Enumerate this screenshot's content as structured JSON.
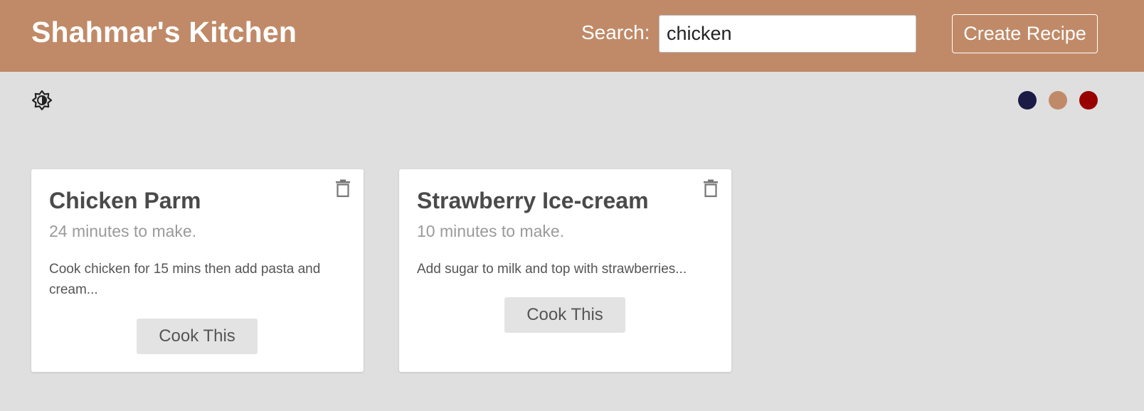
{
  "header": {
    "title": "Shahmar's Kitchen",
    "search_label": "Search:",
    "search_value": "chicken",
    "create_label": "Create Recipe"
  },
  "toolbar": {
    "theme_icon": "brightness-toggle-icon",
    "swatches": [
      {
        "name": "navy",
        "color": "#1b1b46"
      },
      {
        "name": "tan",
        "color": "#c08a68"
      },
      {
        "name": "red",
        "color": "#980000"
      }
    ]
  },
  "recipes": [
    {
      "title": "Chicken Parm",
      "time": "24 minutes to make.",
      "description": "Cook chicken for 15 mins then add pasta and cream...",
      "button_label": "Cook This",
      "delete_icon": "trash-icon"
    },
    {
      "title": "Strawberry Ice-cream",
      "time": "10 minutes to make.",
      "description": "Add sugar to milk and top with strawberries...",
      "button_label": "Cook This",
      "delete_icon": "trash-icon"
    }
  ],
  "colors": {
    "header_bg": "#c08a68",
    "page_bg": "#dfdfdf",
    "card_bg": "#ffffff"
  }
}
